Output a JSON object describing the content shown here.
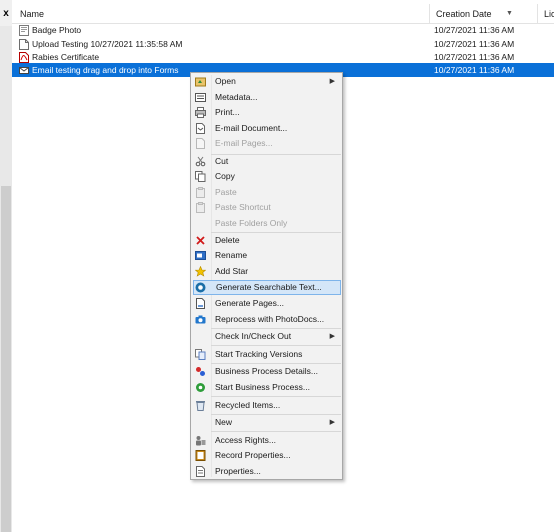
{
  "window": {
    "close_glyph": "x"
  },
  "columns": {
    "name": "Name",
    "creation_date": "Creation Date",
    "sort_glyph": "▼",
    "license": "Lice"
  },
  "rows": [
    {
      "name": "Badge Photo",
      "date": "10/27/2021 11:36 AM",
      "icon": "folder-doc-icon"
    },
    {
      "name": "Upload Testing 10/27/2021 11:35:58 AM",
      "date": "10/27/2021 11:36 AM",
      "icon": "document-icon"
    },
    {
      "name": "Rabies Certificate",
      "date": "10/27/2021 11:36 AM",
      "icon": "pdf-icon"
    },
    {
      "name": "Email testing drag and drop into Forms",
      "date": "10/27/2021 11:36 AM",
      "icon": "envelope-icon",
      "selected": true
    }
  ],
  "menu": {
    "items": [
      {
        "label": "Open",
        "icon": "open-icon",
        "submenu": true
      },
      {
        "label": "Metadata...",
        "icon": "metadata-icon"
      },
      {
        "label": "Print...",
        "icon": "print-icon"
      },
      {
        "label": "E-mail Document...",
        "icon": "email-document-icon"
      },
      {
        "label": "E-mail Pages...",
        "icon": "email-pages-icon",
        "disabled": true
      },
      {
        "label": "Cut",
        "icon": "scissors-icon"
      },
      {
        "label": "Copy",
        "icon": "copy-icon"
      },
      {
        "label": "Paste",
        "icon": "paste-icon",
        "disabled": true
      },
      {
        "label": "Paste Shortcut",
        "icon": "paste-shortcut-icon",
        "disabled": true
      },
      {
        "label": "Paste Folders Only",
        "icon": "none",
        "disabled": true
      },
      {
        "label": "Delete",
        "icon": "delete-x-icon"
      },
      {
        "label": "Rename",
        "icon": "rename-icon"
      },
      {
        "label": "Add Star",
        "icon": "star-icon"
      },
      {
        "label": "Generate Searchable Text...",
        "icon": "searchable-text-icon",
        "highlighted": true
      },
      {
        "label": "Generate Pages...",
        "icon": "generate-pages-icon"
      },
      {
        "label": "Reprocess with PhotoDocs...",
        "icon": "camera-icon"
      },
      {
        "label": "Check In/Check Out",
        "icon": "none",
        "submenu": true
      },
      {
        "label": "Start Tracking Versions",
        "icon": "versions-icon"
      },
      {
        "label": "Business Process Details...",
        "icon": "process-details-icon"
      },
      {
        "label": "Start Business Process...",
        "icon": "start-process-icon"
      },
      {
        "label": "Recycled Items...",
        "icon": "recycle-bin-icon"
      },
      {
        "label": "New",
        "icon": "none",
        "submenu": true
      },
      {
        "label": "Access Rights...",
        "icon": "access-rights-icon"
      },
      {
        "label": "Record Properties...",
        "icon": "record-properties-icon"
      },
      {
        "label": "Properties...",
        "icon": "properties-icon"
      }
    ],
    "submenu_glyph": "▶"
  },
  "colors": {
    "selection": "#0a70d8",
    "menu_highlight": "#d4e6f8",
    "menu_background": "#f2f2f2"
  }
}
